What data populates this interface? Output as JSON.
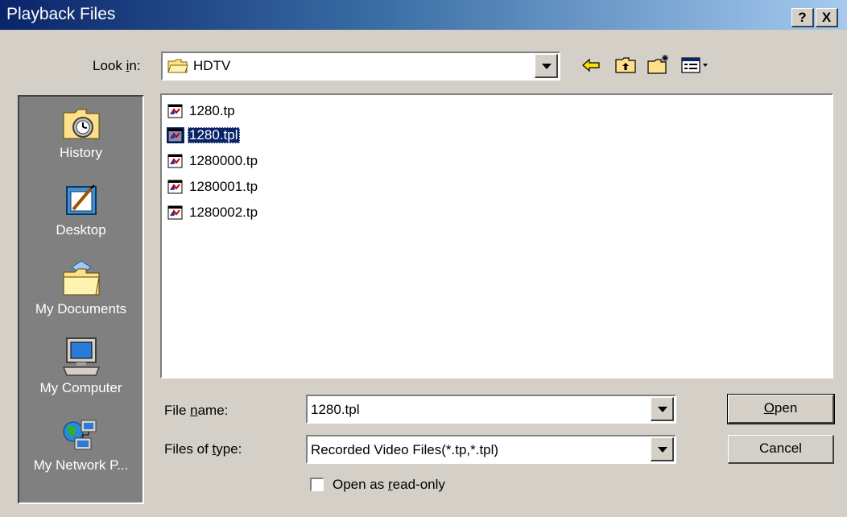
{
  "window": {
    "title": "Playback Files",
    "help_button": "?",
    "close_button": "X"
  },
  "lookin": {
    "label_prefix": "Look ",
    "label_accel": "i",
    "label_suffix": "n:",
    "value": "HDTV"
  },
  "places": [
    {
      "label": "History",
      "icon": "history-icon"
    },
    {
      "label": "Desktop",
      "icon": "desktop-icon"
    },
    {
      "label": "My Documents",
      "icon": "my-documents-icon"
    },
    {
      "label": "My Computer",
      "icon": "my-computer-icon"
    },
    {
      "label": "My Network P...",
      "icon": "my-network-places-icon"
    }
  ],
  "files": [
    {
      "name": "1280.tp",
      "selected": false
    },
    {
      "name": "1280.tpl",
      "selected": true
    },
    {
      "name": "1280000.tp",
      "selected": false
    },
    {
      "name": "1280001.tp",
      "selected": false
    },
    {
      "name": "1280002.tp",
      "selected": false
    }
  ],
  "filename": {
    "label_prefix": "File ",
    "label_accel": "n",
    "label_suffix": "ame:",
    "value": "1280.tpl"
  },
  "filetype": {
    "label_prefix": "Files of ",
    "label_accel": "t",
    "label_suffix": "ype:",
    "value": "Recorded Video Files(*.tp,*.tpl)"
  },
  "readonly": {
    "label_prefix": "Open as ",
    "label_accel": "r",
    "label_suffix": "ead-only",
    "checked": false
  },
  "buttons": {
    "open_accel": "O",
    "open_rest": "pen",
    "cancel": "Cancel"
  },
  "colors": {
    "title_start": "#0a246a",
    "title_end": "#a6caf0",
    "face": "#d4d0c8",
    "places_bg": "#808080",
    "selection": "#0a246a"
  }
}
